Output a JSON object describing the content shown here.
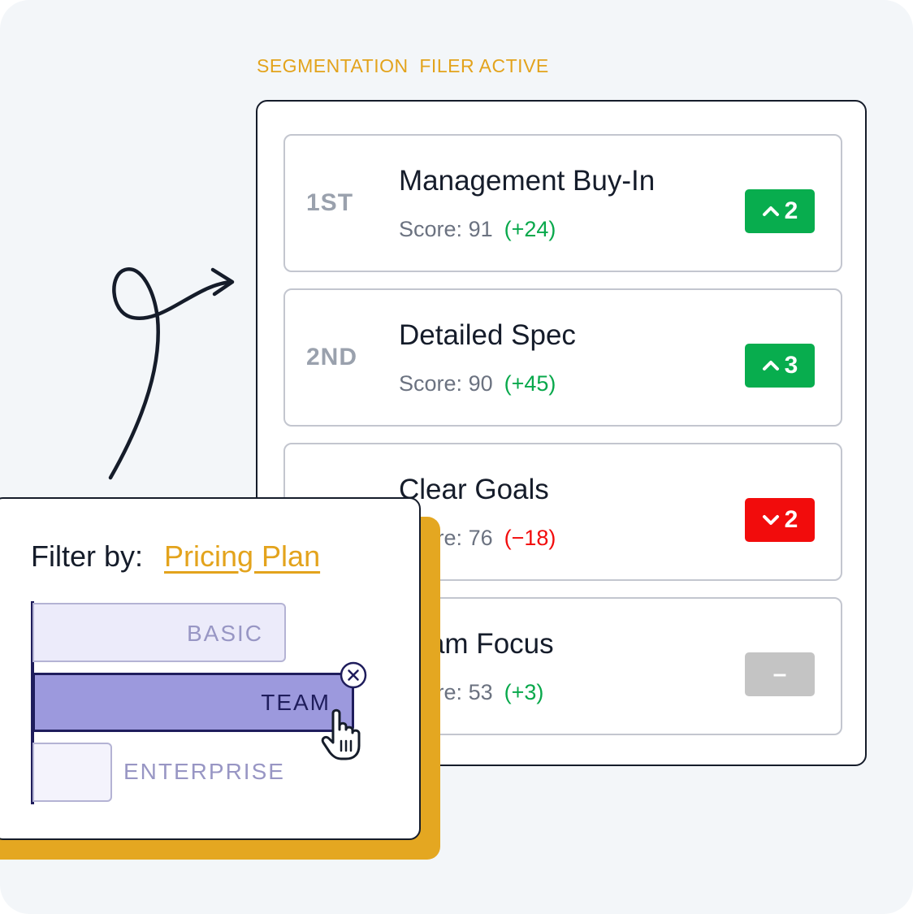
{
  "header": {
    "segmentation_label": "SEGMENTATION  FILER ACTIVE"
  },
  "rankings": [
    {
      "position": "1ST",
      "title": "Management Buy-In",
      "score_prefix": "Score:",
      "score": "91",
      "change": "(+24)",
      "change_direction": "up",
      "badge": "2",
      "badge_direction": "up"
    },
    {
      "position": "2ND",
      "title": "Detailed Spec",
      "score_prefix": "Score:",
      "score": "90",
      "change": "(+45)",
      "change_direction": "up",
      "badge": "3",
      "badge_direction": "up"
    },
    {
      "position": "",
      "title": "Clear Goals",
      "score_prefix": "Score:",
      "score": "76",
      "change": "(−18)",
      "change_direction": "down",
      "badge": "2",
      "badge_direction": "down"
    },
    {
      "position": "",
      "title": "Team Focus",
      "score_prefix": "Score:",
      "score": "53",
      "change": "(+3)",
      "change_direction": "up",
      "badge": "–",
      "badge_direction": "neutral"
    }
  ],
  "filter": {
    "label": "Filter by:",
    "value": "Pricing Plan",
    "options": [
      {
        "label": "BASIC",
        "selected": false,
        "relative_size": 0.79
      },
      {
        "label": "TEAM",
        "selected": true,
        "relative_size": 1.0
      },
      {
        "label": "ENTERPRISE",
        "selected": false,
        "relative_size": 0.25
      }
    ]
  },
  "icons": {
    "chevron_up": "chevron-up-icon",
    "chevron_down": "chevron-down-icon",
    "clear": "close-circle-icon",
    "cursor": "hand-pointer-icon",
    "arrow": "curly-arrow-icon"
  },
  "colors": {
    "accent": "#e3a31c",
    "up": "#08ad4e",
    "down": "#f20c0c",
    "neutral": "#c4c4c4",
    "bar_selected": "#9c99dd",
    "bar_dark": "#1f1d5c"
  }
}
